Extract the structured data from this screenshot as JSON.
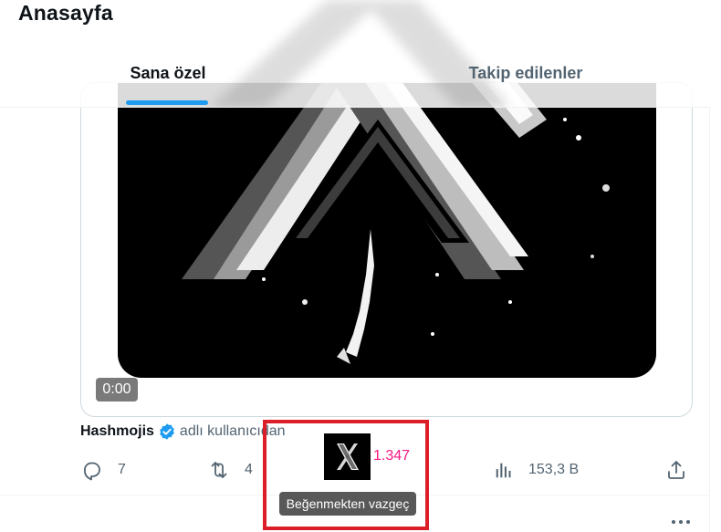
{
  "header": {
    "title": "Anasayfa",
    "tabs": [
      {
        "label": "Sana özel",
        "active": true
      },
      {
        "label": "Takip edilenler",
        "active": false
      }
    ]
  },
  "media": {
    "duration": "0:00",
    "logo_icon": "x-logo-icon"
  },
  "attribution": {
    "name": "Hashmojis",
    "suffix": "adlı kullanıcıdan",
    "verified_icon": "verified-badge-icon"
  },
  "actions": {
    "reply_count": "7",
    "repost_count": "4",
    "like_count": "1.347",
    "views_count": "153,3 B"
  },
  "tooltip": {
    "text": "Beğenmekten vazgeç"
  },
  "colors": {
    "accent": "#1d9bf0",
    "like": "#f91880",
    "highlight": "#dc1e28",
    "muted": "#536471"
  }
}
